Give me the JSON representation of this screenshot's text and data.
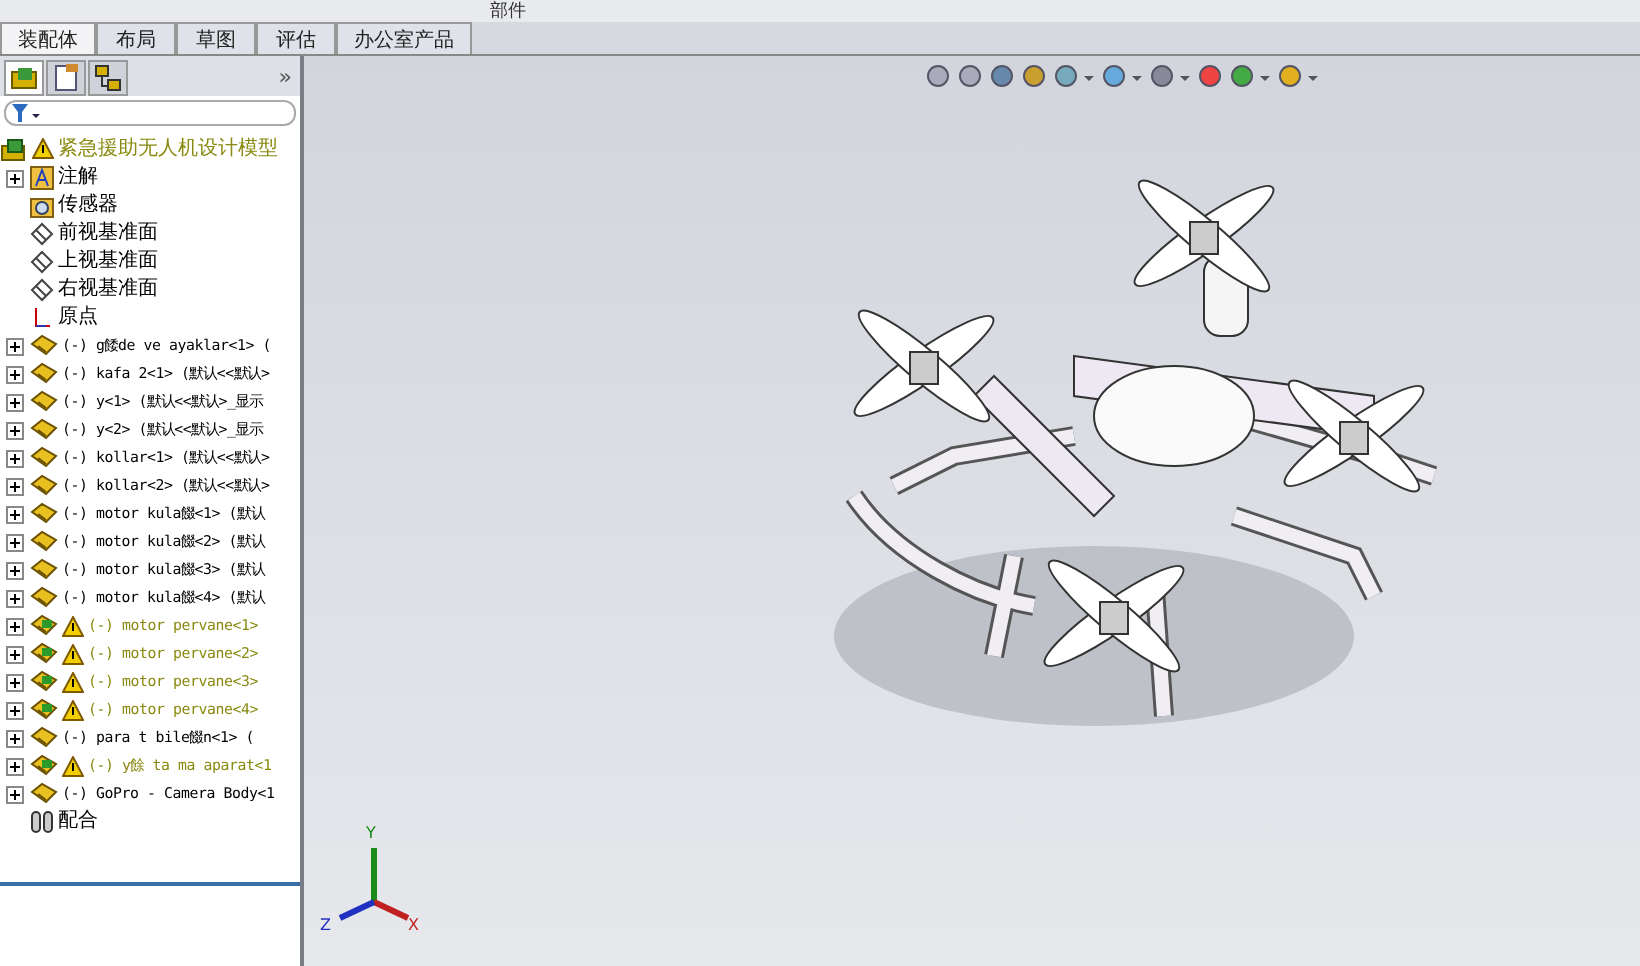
{
  "top_strip": {
    "label": "部件"
  },
  "tabs": [
    {
      "label": "装配体",
      "selected": true
    },
    {
      "label": "布局",
      "selected": false
    },
    {
      "label": "草图",
      "selected": false
    },
    {
      "label": "评估",
      "selected": false
    },
    {
      "label": "办公室产品",
      "selected": false
    }
  ],
  "panel_tabs": [
    {
      "kind": "tree",
      "selected": true
    },
    {
      "kind": "property",
      "selected": false
    },
    {
      "kind": "config",
      "selected": false
    }
  ],
  "panel_more": "»",
  "tree": {
    "root": {
      "label": "紧急援助无人机设计模型",
      "warning": true
    },
    "items": [
      {
        "kind": "annotation",
        "label": "注解",
        "expandable": true,
        "warning": false
      },
      {
        "kind": "sensor",
        "label": "传感器",
        "expandable": false,
        "warning": false
      },
      {
        "kind": "plane",
        "label": "前视基准面",
        "expandable": false,
        "warning": false
      },
      {
        "kind": "plane",
        "label": "上视基准面",
        "expandable": false,
        "warning": false
      },
      {
        "kind": "plane",
        "label": "右视基准面",
        "expandable": false,
        "warning": false
      },
      {
        "kind": "origin",
        "label": "原点",
        "expandable": false,
        "warning": false
      },
      {
        "kind": "part",
        "label": "(-) g餧de ve ayaklar<1> (",
        "expandable": true,
        "warning": false
      },
      {
        "kind": "part",
        "label": "(-) kafa 2<1> (默认<<默认>",
        "expandable": true,
        "warning": false
      },
      {
        "kind": "part",
        "label": "(-) y<1> (默认<<默认>_显示",
        "expandable": true,
        "warning": false
      },
      {
        "kind": "part",
        "label": "(-) y<2> (默认<<默认>_显示",
        "expandable": true,
        "warning": false
      },
      {
        "kind": "part",
        "label": "(-) kollar<1> (默认<<默认>",
        "expandable": true,
        "warning": false
      },
      {
        "kind": "part",
        "label": "(-) kollar<2> (默认<<默认>",
        "expandable": true,
        "warning": false
      },
      {
        "kind": "part",
        "label": "(-) motor kula餟<1> (默认",
        "expandable": true,
        "warning": false
      },
      {
        "kind": "part",
        "label": "(-) motor kula餟<2> (默认",
        "expandable": true,
        "warning": false
      },
      {
        "kind": "part",
        "label": "(-) motor kula餟<3> (默认",
        "expandable": true,
        "warning": false
      },
      {
        "kind": "part",
        "label": "(-) motor kula餟<4> (默认",
        "expandable": true,
        "warning": false
      },
      {
        "kind": "part",
        "label": "(-) motor pervane<1>",
        "expandable": true,
        "warning": true
      },
      {
        "kind": "part",
        "label": "(-) motor pervane<2>",
        "expandable": true,
        "warning": true
      },
      {
        "kind": "part",
        "label": "(-) motor pervane<3>",
        "expandable": true,
        "warning": true
      },
      {
        "kind": "part",
        "label": "(-) motor pervane<4>",
        "expandable": true,
        "warning": true
      },
      {
        "kind": "part",
        "label": "(-) para  t bile餟n<1> (",
        "expandable": true,
        "warning": false
      },
      {
        "kind": "part",
        "label": "(-) y餘 ta  ma aparat<1",
        "expandable": true,
        "warning": true
      },
      {
        "kind": "part",
        "label": "(-) GoPro - Camera Body<1",
        "expandable": true,
        "warning": false
      },
      {
        "kind": "mates",
        "label": "配合",
        "expandable": false,
        "warning": false
      }
    ]
  },
  "axes": {
    "x": "X",
    "y": "Y",
    "z": "Z"
  }
}
